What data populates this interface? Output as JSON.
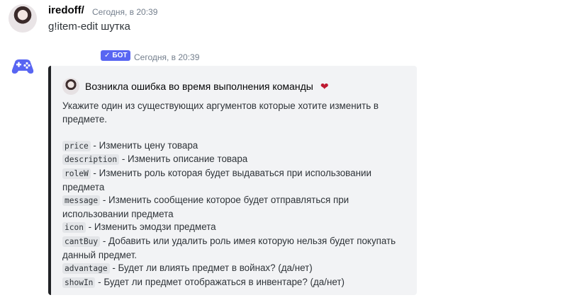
{
  "user_message": {
    "username": "iredoff/",
    "timestamp": "Сегодня, в 20:39",
    "text": "g!item-edit шутка"
  },
  "bot_message": {
    "badge": "БОТ",
    "timestamp": "Сегодня, в 20:39",
    "embed": {
      "accent_color": "#202225",
      "author": "Возникла ошибка во время выполнения команды",
      "intro": "Укажите один из существующих аргументов которые хотите изменить в предмете.",
      "args": [
        {
          "code": "price",
          "text": " - Изменить цену товара"
        },
        {
          "code": "description",
          "text": " - Изменить описание товара"
        },
        {
          "code": "roleW",
          "text": " - Изменить роль которая будет выдаваться при использовании предмета"
        },
        {
          "code": "message",
          "text": " - Изменить сообщение которое будет отправляться при использовании предмета"
        },
        {
          "code": "icon",
          "text": " - Изменить эмодзи предмета"
        },
        {
          "code": "cantBuy",
          "text": " - Добавить или удалить роль имея которую нельзя будет покупать данный предмет."
        },
        {
          "code": "advantage",
          "text": " - Будет ли влиять предмет в войнах? (да/нет)"
        },
        {
          "code": "showIn",
          "text": " - Будет ли предмет отображаться в инвентаре? (да/нет)"
        }
      ]
    }
  },
  "icons": {
    "user_avatar": "user-avatar",
    "bot_avatar": "gamepad-icon",
    "badge_check": "check-icon",
    "heart": "heart-icon"
  },
  "colors": {
    "bot_badge": "#5865f2",
    "bot_avatar": "#5865f2",
    "heart": "#be1931"
  }
}
